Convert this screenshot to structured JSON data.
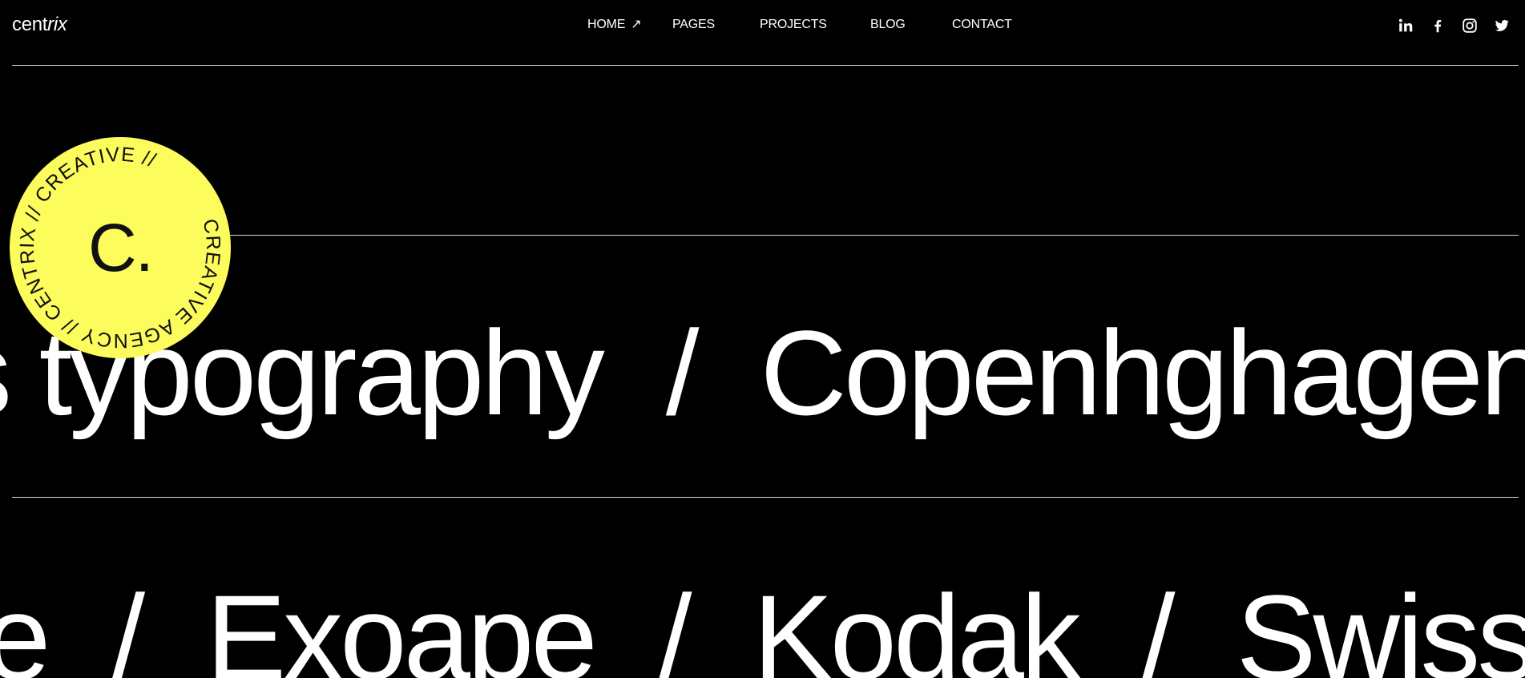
{
  "brand": {
    "name_a": "cent",
    "name_b": "rix"
  },
  "nav": {
    "items": [
      {
        "label": "HOME",
        "icon": "arrow-up-right-icon",
        "active": true
      },
      {
        "label": "PAGES"
      },
      {
        "label": "PROJECTS"
      },
      {
        "label": "BLOG"
      },
      {
        "label": "CONTACT"
      }
    ],
    "home_arrow": "↗"
  },
  "social": [
    "linkedin-icon",
    "facebook-icon",
    "instagram-icon",
    "twitter-icon"
  ],
  "badge": {
    "center": "C.",
    "ring_text": "CREATIVE AGENCY  //  CENTRIX  //  CREATIVE  //",
    "color": "#fcfc5c"
  },
  "marquee": {
    "row1": [
      "s typography",
      "Copenhghagen"
    ],
    "row2": [
      "e",
      "Exoape",
      "Kodak",
      "Swiss t"
    ],
    "separator": "/"
  },
  "colors": {
    "background": "#000000",
    "text": "#ffffff",
    "accent": "#fcfc5c"
  }
}
